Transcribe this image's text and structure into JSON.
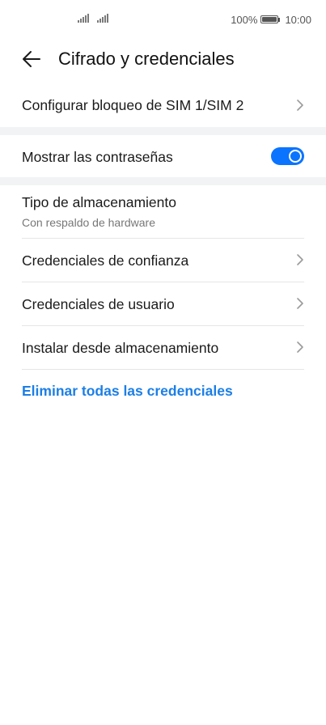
{
  "status_bar": {
    "battery_percent": "100%",
    "time": "10:00",
    "battery_level": 1.0
  },
  "header": {
    "title": "Cifrado y credenciales",
    "back_icon": "arrow-left-icon"
  },
  "items": {
    "sim_lock": {
      "label": "Configurar bloqueo de SIM 1/SIM 2"
    },
    "show_passwords": {
      "label": "Mostrar las contraseñas",
      "enabled": true
    },
    "storage_type": {
      "label": "Tipo de almacenamiento",
      "value": "Con respaldo de hardware"
    },
    "trusted_credentials": {
      "label": "Credenciales de confianza"
    },
    "user_credentials": {
      "label": "Credenciales de usuario"
    },
    "install_from_storage": {
      "label": "Instalar desde almacenamiento"
    },
    "clear_credentials": {
      "label": "Eliminar todas las credenciales"
    }
  },
  "colors": {
    "accent": "#0a74ff",
    "link": "#1c7fe6",
    "section_gap": "#f1f3f5"
  }
}
